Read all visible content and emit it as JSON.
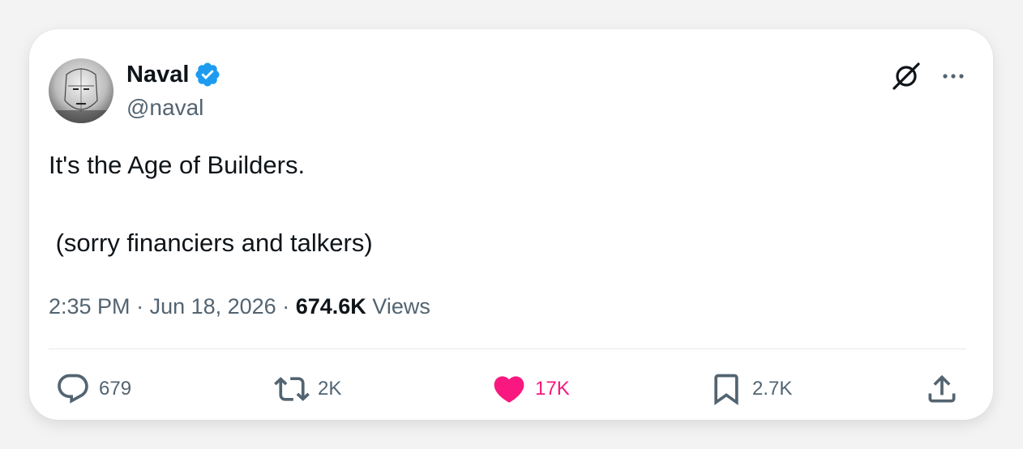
{
  "author": {
    "name": "Naval",
    "handle": "@naval",
    "verified": true,
    "verified_color": "#1d9bf0"
  },
  "header_icons": [
    "grok-icon",
    "more-icon"
  ],
  "tweet": {
    "lines": [
      "It's the Age of Builders.",
      " (sorry financiers and talkers)"
    ]
  },
  "meta": {
    "time": "2:35 PM",
    "date": "Jun 18, 2026",
    "views_count": "674.6K",
    "views_label": "Views"
  },
  "actions": {
    "replies": "679",
    "retweets": "2K",
    "likes": "17K",
    "bookmarks": "2.7K"
  },
  "colors": {
    "text": "#0f1419",
    "secondary": "#536471",
    "like": "#f91880"
  }
}
